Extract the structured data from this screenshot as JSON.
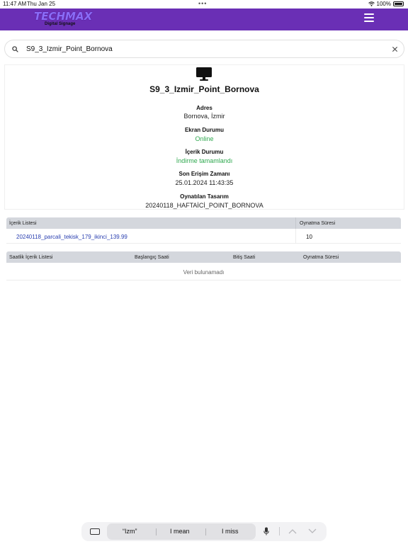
{
  "status_bar": {
    "time": "11:47 AM",
    "date": "Thu Jan 25",
    "dots": "•••",
    "battery": "100%"
  },
  "header": {
    "logo_text": "TECHMAX",
    "logo_subtitle": "Digital Signage",
    "brand_color": "#6a2fb5",
    "menu_icon": "hamburger-menu-icon"
  },
  "search": {
    "value": "S9_3_Izmir_Point_Bornova",
    "search_icon": "search-icon",
    "clear_icon": "close-icon"
  },
  "device": {
    "icon": "desktop-monitor-icon",
    "name": "S9_3_Izmir_Point_Bornova",
    "fields": [
      {
        "label": "Adres",
        "value": "Bornova, İzmir"
      },
      {
        "label": "Ekran Durumu",
        "value": "Online"
      },
      {
        "label": "İçerik Durumu",
        "value": "İndirme tamamlandı"
      },
      {
        "label": "Son Erişim Zamanı",
        "value": "25.01.2024 11:43:35"
      },
      {
        "label": "Oynatılan Tasarım",
        "value": "20240118_HAFTAİCİ_POINT_BORNOVA"
      }
    ],
    "status_color": "#2fa84f"
  },
  "content_table": {
    "headers": [
      "İçerik Listesi",
      "Oynatma Süresi"
    ],
    "rows": [
      {
        "name": "20240118_parcali_tekisk_179_ikinci_139.99",
        "duration": "10"
      }
    ]
  },
  "hourly_table": {
    "headers": [
      "Saatlik İçerik Listesi",
      "Başlangıç Saati",
      "Bitiş Saati",
      "Oynatma Süresi"
    ],
    "empty_message": "Veri bulunamadı"
  },
  "keyboard_bar": {
    "suggestions": [
      "“Izm”",
      "I mean",
      "I miss"
    ],
    "keyboard_icon": "keyboard-icon",
    "mic_icon": "microphone-icon",
    "up_icon": "chevron-up-icon",
    "down_icon": "chevron-down-icon"
  }
}
